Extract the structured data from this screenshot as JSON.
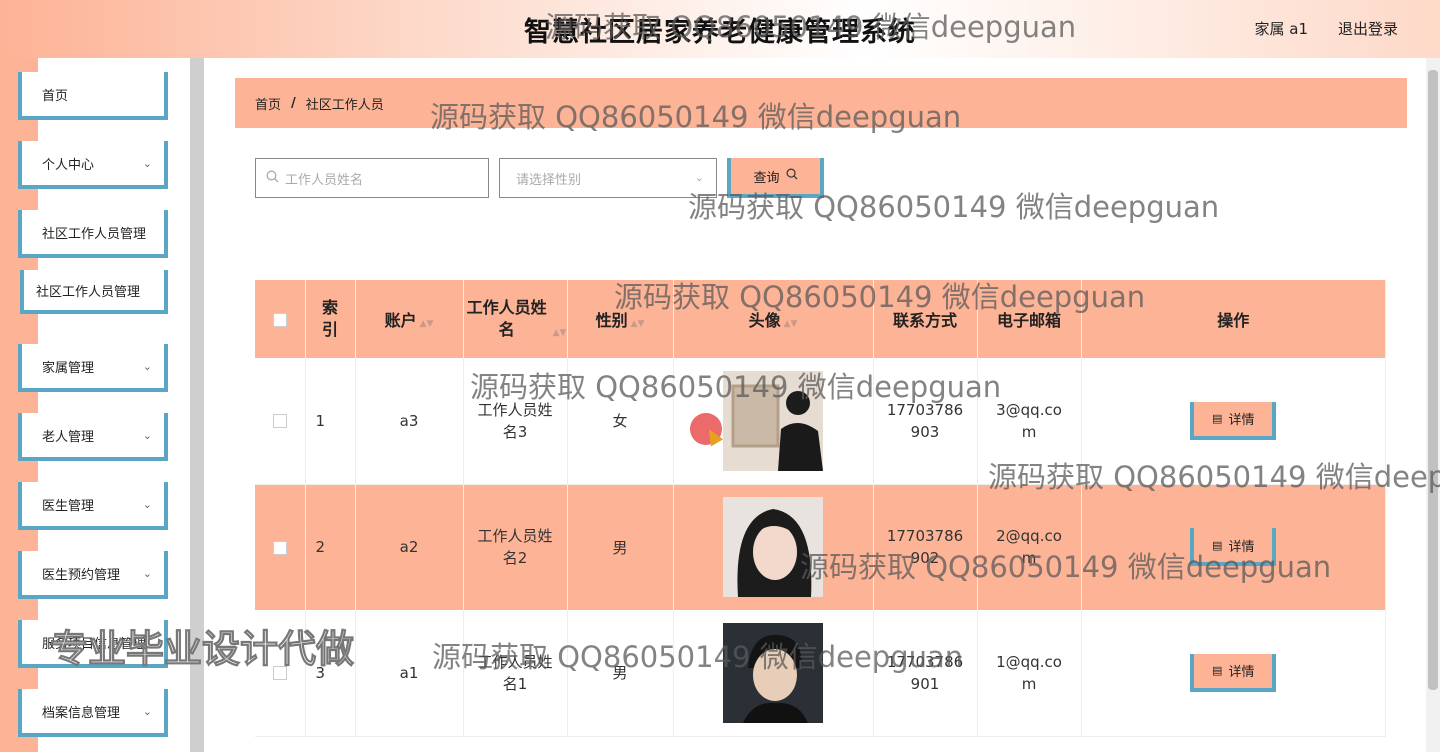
{
  "header": {
    "title": "智慧社区居家养老健康管理系统",
    "user_label": "家属 a1",
    "logout_label": "退出登录"
  },
  "sidebar": {
    "items": [
      {
        "label": "首页",
        "has_chevron": false
      },
      {
        "label": "个人中心",
        "has_chevron": true
      },
      {
        "label": "社区工作人员管理",
        "has_chevron": false
      },
      {
        "label": "社区工作人员管理",
        "has_chevron": false
      },
      {
        "label": "家属管理",
        "has_chevron": true
      },
      {
        "label": "老人管理",
        "has_chevron": true
      },
      {
        "label": "医生管理",
        "has_chevron": true
      },
      {
        "label": "医生预约管理",
        "has_chevron": true
      },
      {
        "label": "服务项目信息管理",
        "has_chevron": false
      },
      {
        "label": "档案信息管理",
        "has_chevron": true
      }
    ]
  },
  "breadcrumb": {
    "home": "首页",
    "separator": "/",
    "current": "社区工作人员"
  },
  "search": {
    "name_placeholder": "工作人员姓名",
    "gender_placeholder": "请选择性别",
    "query_label": "查询"
  },
  "table": {
    "headers": {
      "index": "索引",
      "account": "账户",
      "name": "工作人员姓名",
      "gender": "性别",
      "avatar": "头像",
      "phone": "联系方式",
      "email": "电子邮箱",
      "actions": "操作"
    },
    "rows": [
      {
        "index": "1",
        "account": "a3",
        "name": "工作人员姓名3",
        "gender": "女",
        "phone": "17703786903",
        "email": "3@qq.com",
        "detail": "详情"
      },
      {
        "index": "2",
        "account": "a2",
        "name": "工作人员姓名2",
        "gender": "男",
        "phone": "17703786902",
        "email": "2@qq.com",
        "detail": "详情"
      },
      {
        "index": "3",
        "account": "a1",
        "name": "工作人员姓名1",
        "gender": "男",
        "phone": "17703786901",
        "email": "1@qq.com",
        "detail": "详情"
      }
    ]
  },
  "watermark": {
    "text": "源码获取 QQ86050149 微信deepguan",
    "big_text": "专业毕业设计代做"
  },
  "colors": {
    "accent": "#fdb396",
    "border_blue": "#5aa7c5"
  },
  "icons": {
    "search": "search-icon",
    "chevron": "chevron-down-icon",
    "detail": "document-icon"
  }
}
